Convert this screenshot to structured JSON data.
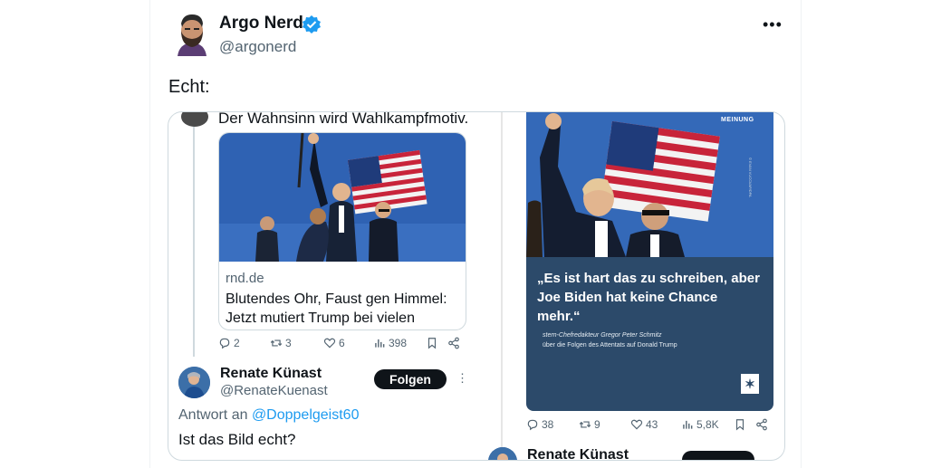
{
  "author": {
    "name": "Argo Nerd",
    "handle": "@argonerd"
  },
  "tweet": {
    "text": "Echt:"
  },
  "quoted_left": {
    "text": "Der Wahnsinn wird Wahlkampfmotiv.",
    "card": {
      "domain": "rnd.de",
      "title": "Blutendes Ohr, Faust gen Himmel: Jetzt mutiert Trump bei vielen endg..."
    },
    "actions": {
      "replies": "2",
      "reposts": "3",
      "likes": "6",
      "views": "398"
    },
    "reply": {
      "name": "Renate Künast",
      "handle": "@RenateKuenast",
      "follow_label": "Folgen",
      "reply_to_prefix": "Antwort an",
      "reply_to_handle": "@Doppelgeist60",
      "text": "Ist das Bild echt?"
    }
  },
  "quoted_right": {
    "label": "MEINUNG",
    "credit": "© EVAN VUCCI/AP/DPA",
    "quote": "„Es ist hart das zu schreiben, aber Joe Biden hat keine Chance mehr.“",
    "subtitle_1": "stern-Chefredakteur Gregor Peter Schmitz",
    "subtitle_2": "über die Folgen des Attentats auf Donald Trump",
    "actions": {
      "replies": "38",
      "reposts": "9",
      "likes": "43",
      "views": "5,8K"
    },
    "next_reply_name": "Renate Künast"
  },
  "colors": {
    "accent": "#1d9bf0",
    "stern_blue": "#2c4a6a",
    "follow_bg": "#0f1419"
  },
  "icons": [
    "verified-icon",
    "more-icon",
    "reply-icon",
    "repost-icon",
    "like-icon",
    "views-icon",
    "bookmark-icon",
    "share-icon"
  ]
}
